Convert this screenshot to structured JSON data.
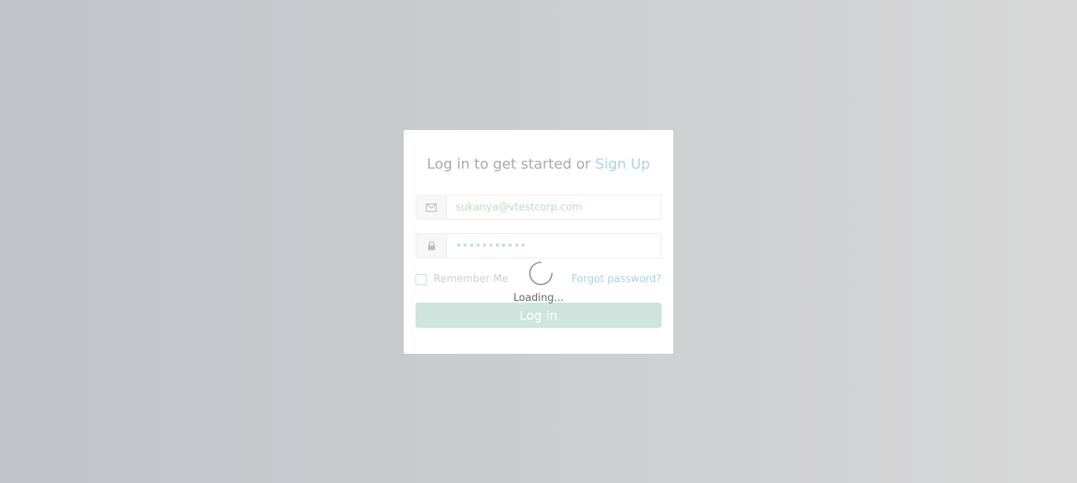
{
  "login": {
    "title_prefix": "Log in to get started or",
    "signup_label": "Sign Up",
    "email": {
      "value": "sukanya@vtestcorp.com",
      "icon": "envelope-icon"
    },
    "password": {
      "value": "•••••••••••",
      "icon": "lock-icon"
    },
    "remember_label": "Remember Me",
    "remember_checked": false,
    "forgot_label": "Forgot password?",
    "submit_label": "Log in"
  },
  "loader": {
    "text": "Loading..."
  },
  "colors": {
    "link": "#a9d1e9",
    "button": "#cde5dd",
    "input_text": "#b9e0c4"
  }
}
